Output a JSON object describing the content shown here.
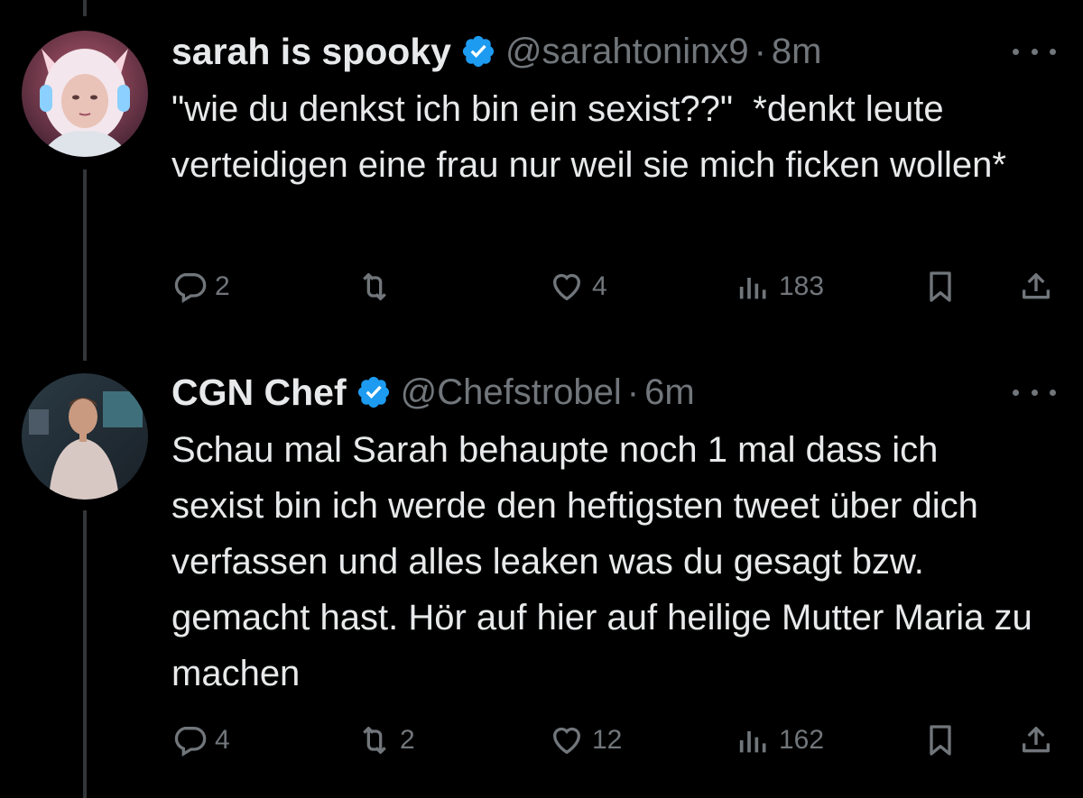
{
  "tweets": [
    {
      "name": "sarah is spooky",
      "handle": "@sarahtoninx9",
      "separator": "·",
      "time": "8m",
      "text": "\"wie du denkst ich bin ein sexist??\"  *denkt leute verteidigen eine frau nur weil sie mich ficken wollen*",
      "stats": {
        "replies": "2",
        "retweets": "",
        "likes": "4",
        "views": "183"
      }
    },
    {
      "name": "CGN Chef",
      "handle": "@Chefstrobel",
      "separator": "·",
      "time": "6m",
      "text": "Schau mal Sarah behaupte noch 1 mal dass ich sexist bin ich werde den heftigsten tweet über dich verfassen und alles leaken was du gesagt bzw. gemacht hast. Hör auf hier auf heilige Mutter Maria zu machen",
      "stats": {
        "replies": "4",
        "retweets": "2",
        "likes": "12",
        "views": "162"
      }
    }
  ],
  "colors": {
    "background": "#000000",
    "text": "#e7e9ea",
    "muted": "#71767b",
    "verified": "#1d9bf0"
  },
  "icons": [
    "reply-icon",
    "retweet-icon",
    "like-icon",
    "views-icon",
    "bookmark-icon",
    "share-icon",
    "verified-badge-icon",
    "more-icon"
  ]
}
